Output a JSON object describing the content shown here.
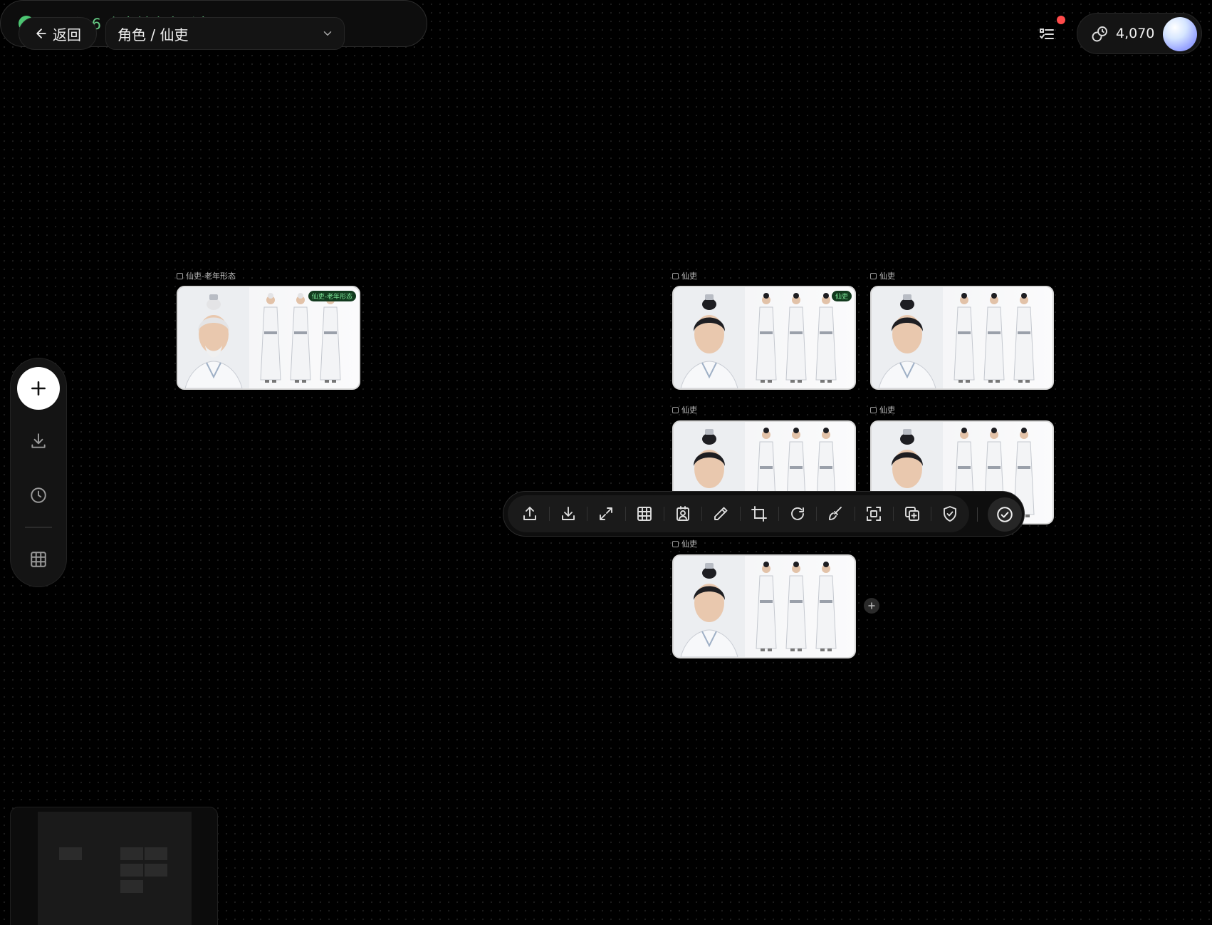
{
  "header": {
    "back_label": "返回",
    "asset_selector_value": "角色 / 仙吏",
    "toast_message": "已导入 6 个当前资产形态图",
    "credits": "4,070"
  },
  "canvas": {
    "cards": [
      {
        "label": "仙吏-老年形态",
        "badge": "仙吏-老年形态",
        "hair": "white"
      },
      {
        "label": "仙吏",
        "badge": "仙吏",
        "hair": "dark"
      },
      {
        "label": "仙吏",
        "badge": "",
        "hair": "dark"
      },
      {
        "label": "仙吏",
        "badge": "",
        "hair": "dark"
      },
      {
        "label": "仙吏",
        "badge": "",
        "hair": "dark"
      },
      {
        "label": "仙吏",
        "badge": "",
        "hair": "dark"
      }
    ]
  },
  "toolbar": {
    "items": [
      {
        "icon": "upload-icon"
      },
      {
        "icon": "download-icon"
      },
      {
        "icon": "expand-icon"
      },
      {
        "icon": "grid-split-icon"
      },
      {
        "icon": "portrait-icon"
      },
      {
        "icon": "pencil-icon"
      },
      {
        "icon": "crop-icon"
      },
      {
        "icon": "rotate-icon"
      },
      {
        "icon": "brush-icon"
      },
      {
        "icon": "image-extend-icon"
      },
      {
        "icon": "duplicate-icon"
      },
      {
        "icon": "shield-check-icon"
      }
    ],
    "confirm_icon": "check-circle-icon"
  },
  "colors": {
    "success": "#66cc85",
    "notification": "#ff4b4b",
    "background": "#000000"
  }
}
